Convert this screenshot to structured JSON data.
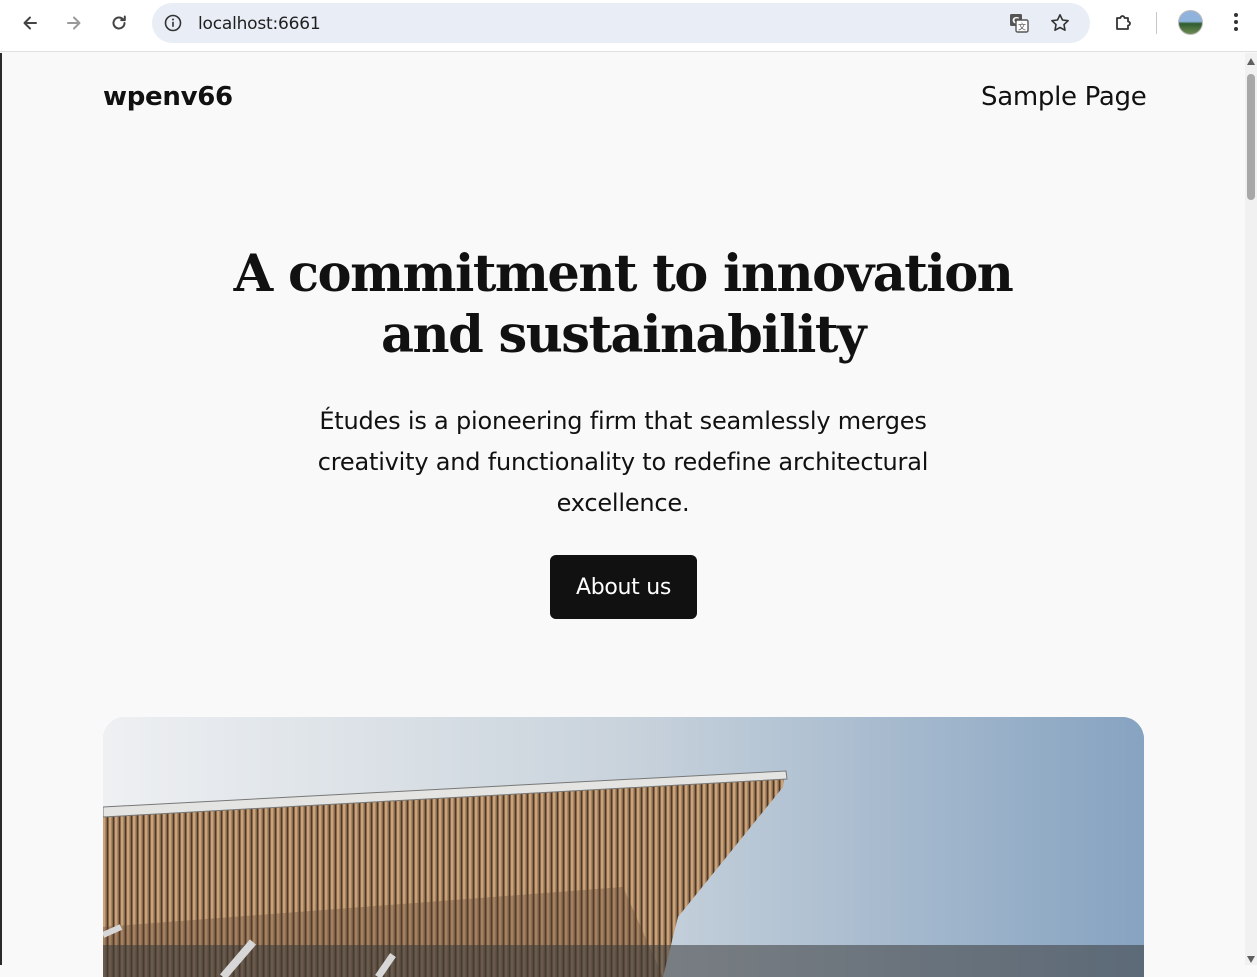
{
  "browser": {
    "url": "localhost:6661",
    "profile_avatar": "profile-avatar"
  },
  "site": {
    "title": "wpenv66",
    "nav": [
      {
        "label": "Sample Page"
      }
    ]
  },
  "hero": {
    "heading_line1": "A commitment to innovation",
    "heading_line2": "and sustainability",
    "description": "Études is a pioneering firm that seamlessly merges creativity and functionality to redefine architectural excellence.",
    "button_label": "About us"
  },
  "colors": {
    "background": "#f9f9f9",
    "text": "#111111",
    "button_bg": "#111111",
    "button_text": "#ffffff"
  }
}
